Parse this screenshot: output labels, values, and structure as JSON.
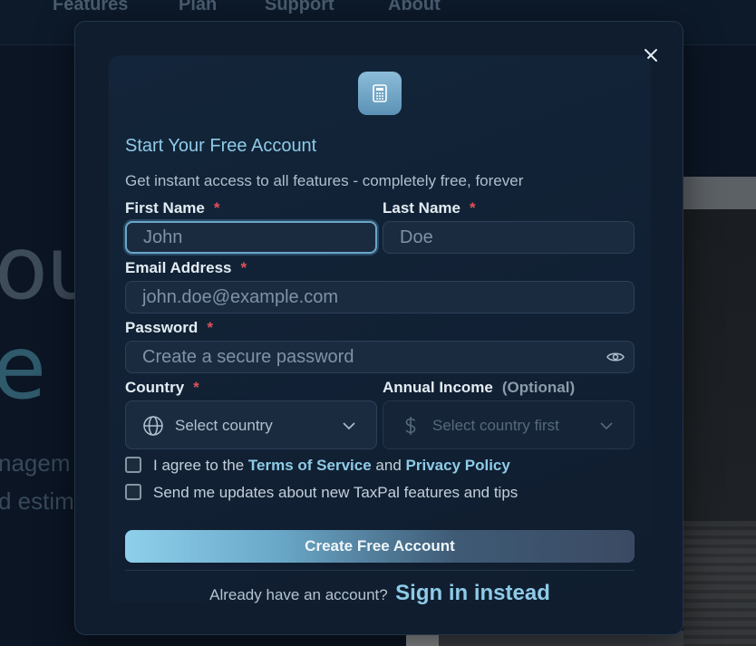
{
  "background": {
    "nav": [
      "Features",
      "Plan",
      "Support",
      "About"
    ],
    "hero_line1": "ou",
    "hero_line2": "e",
    "sub_line1": "nagem",
    "sub_line2": "d estim"
  },
  "modal": {
    "close_icon": "close-icon",
    "logo_icon": "calculator-icon",
    "title": "Start Your Free Account",
    "subtitle": "Get instant access to all features - completely free, forever",
    "fields": {
      "first_name": {
        "label": "First Name",
        "required": "*",
        "placeholder": "John"
      },
      "last_name": {
        "label": "Last Name",
        "required": "*",
        "placeholder": "Doe"
      },
      "email": {
        "label": "Email Address",
        "required": "*",
        "placeholder": "john.doe@example.com"
      },
      "password": {
        "label": "Password",
        "required": "*",
        "placeholder": "Create a secure password",
        "toggle_icon": "eye-icon"
      },
      "country": {
        "label": "Country",
        "required": "*",
        "value": "Select country",
        "icon": "globe-icon"
      },
      "income": {
        "label": "Annual Income",
        "optional": "(Optional)",
        "value": "Select country first",
        "icon": "dollar-icon"
      }
    },
    "terms": {
      "prefix": "I agree to the",
      "tos": "Terms of Service",
      "and": "and",
      "privacy": "Privacy Policy"
    },
    "updates": "Send me updates about new TaxPal features and tips",
    "submit": "Create Free Account",
    "signin_prompt": "Already have an account?",
    "signin_link": "Sign in instead"
  },
  "colors": {
    "accent": "#8ecbe8",
    "required": "#e0505a",
    "background": "#0b1524"
  }
}
